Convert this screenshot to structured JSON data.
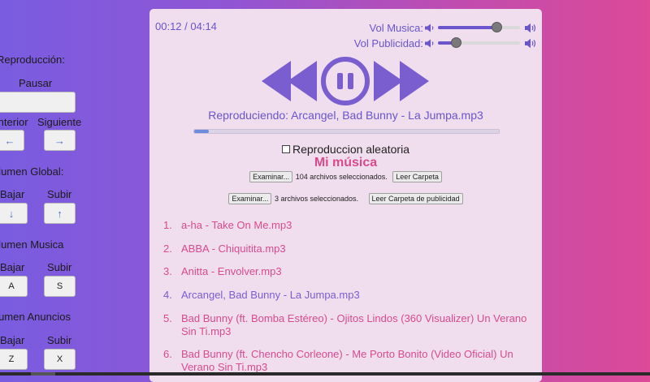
{
  "sidebar": {
    "heading_playback": "Reproducción:",
    "pause_label": "Pausar",
    "pause_key": "",
    "prev_label": "Anterior",
    "next_label": "Siguiente",
    "prev_key": "←",
    "next_key": "→",
    "heading_global": "Volumen Global:",
    "global_down_label": "Bajar",
    "global_up_label": "Subir",
    "global_down_key": "↓",
    "global_up_key": "↑",
    "heading_music": "Volumen Musica",
    "music_down_label": "Bajar",
    "music_up_label": "Subir",
    "music_down_key": "A",
    "music_up_key": "S",
    "heading_ads": "Volumen Anuncios",
    "ads_down_label": "Bajar",
    "ads_up_label": "Subir",
    "ads_down_key": "Z",
    "ads_up_key": "X"
  },
  "player": {
    "time": "00:12 / 04:14",
    "vol_music_label": "Vol Musica:",
    "vol_music_level": 0.7,
    "vol_ads_label": "Vol Publicidad:",
    "vol_ads_level": 0.21,
    "now_playing": "Reproduciendo: Arcangel, Bad Bunny - La Jumpa.mp3",
    "progress": 0.047,
    "shuffle_label": "Reproduccion aleatoria",
    "shuffle_checked": false
  },
  "library": {
    "title": "Mi música",
    "music_browse": "Examinar...",
    "music_selected": "104 archivos seleccionados.",
    "music_read": "Leer Carpeta",
    "ads_browse": "Examinar...",
    "ads_selected": "3 archivos seleccionados.",
    "ads_read": "Leer Carpeta de publicidad"
  },
  "songs": [
    {
      "num": "1.",
      "title": "a-ha - Take On Me.mp3"
    },
    {
      "num": "2.",
      "title": "ABBA - Chiquitita.mp3"
    },
    {
      "num": "3.",
      "title": "Anitta - Envolver.mp3"
    },
    {
      "num": "4.",
      "title": "Arcangel, Bad Bunny - La Jumpa.mp3"
    },
    {
      "num": "5.",
      "title": "Bad Bunny (ft. Bomba Estéreo) - Ojitos Lindos (360 Visualizer) Un Verano Sin Ti.mp3"
    },
    {
      "num": "6.",
      "title": "Bad Bunny (ft. Chencho Corleone) - Me Porto Bonito (Video Oficial) Un Verano Sin Ti.mp3"
    }
  ],
  "colors": {
    "accent": "#6a55cc",
    "pink": "#d84b8f",
    "card_bg": "#f0ddee"
  },
  "icons": {
    "speaker": "speaker-icon",
    "previous": "previous-icon",
    "pause": "pause-icon",
    "next": "next-icon"
  }
}
